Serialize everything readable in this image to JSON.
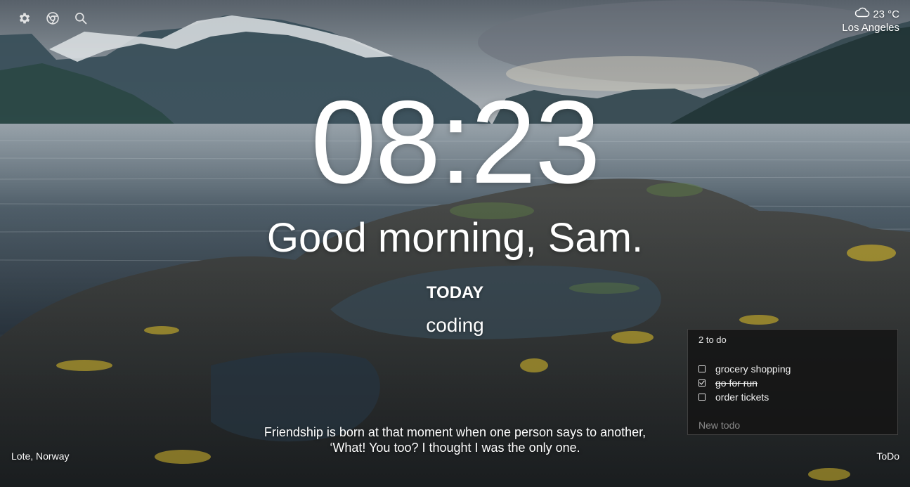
{
  "toolbar": {
    "icons": [
      "gear-icon",
      "chrome-icon",
      "search-icon"
    ]
  },
  "weather": {
    "icon": "cloud-icon",
    "temperature": "23 °C",
    "city": "Los Angeles"
  },
  "clock": {
    "time": "08:23"
  },
  "greeting": {
    "text": "Good morning, Sam."
  },
  "focus": {
    "label": "TODAY",
    "value": "coding"
  },
  "quote": {
    "line1": "Friendship is born at that moment when one person says to another,",
    "line2": "‘What! You too? I thought I was the only one."
  },
  "background": {
    "location": "Lote, Norway"
  },
  "todo_link": {
    "label": "ToDo"
  },
  "todo": {
    "count_text": "2 to do",
    "items": [
      {
        "text": "grocery shopping",
        "done": false
      },
      {
        "text": "go for run",
        "done": true
      },
      {
        "text": "order tickets",
        "done": false
      }
    ],
    "new_placeholder": "New todo"
  }
}
